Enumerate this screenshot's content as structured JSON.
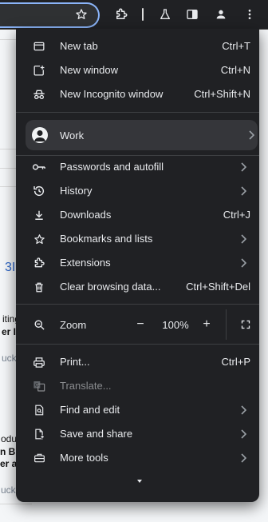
{
  "background": {
    "partial_texts": [
      "3I",
      "iting",
      "er I",
      "uck",
      "odu",
      "n BI",
      "er a",
      "uck"
    ]
  },
  "menu": {
    "top_items": [
      {
        "label": "New tab",
        "shortcut": "Ctrl+T"
      },
      {
        "label": "New window",
        "shortcut": "Ctrl+N"
      },
      {
        "label": "New Incognito window",
        "shortcut": "Ctrl+Shift+N"
      }
    ],
    "profile": {
      "label": "Work"
    },
    "middle_items": [
      {
        "label": "Passwords and autofill",
        "shortcut": ""
      },
      {
        "label": "History",
        "shortcut": ""
      },
      {
        "label": "Downloads",
        "shortcut": "Ctrl+J"
      },
      {
        "label": "Bookmarks and lists",
        "shortcut": ""
      },
      {
        "label": "Extensions",
        "shortcut": ""
      },
      {
        "label": "Clear browsing data...",
        "shortcut": "Ctrl+Shift+Del"
      }
    ],
    "zoom": {
      "label": "Zoom",
      "minus": "−",
      "value": "100%",
      "plus": "+"
    },
    "bottom_items": [
      {
        "label": "Print...",
        "shortcut": "Ctrl+P"
      },
      {
        "label": "Translate...",
        "shortcut": ""
      },
      {
        "label": "Find and edit",
        "shortcut": ""
      },
      {
        "label": "Save and share",
        "shortcut": ""
      },
      {
        "label": "More tools",
        "shortcut": ""
      }
    ]
  },
  "colors": {
    "menu_bg": "#202124",
    "text": "#e8eaed",
    "disabled_text": "#8a8c8f",
    "accent": "#8ab4f8",
    "hover_bg": "#35363a"
  }
}
